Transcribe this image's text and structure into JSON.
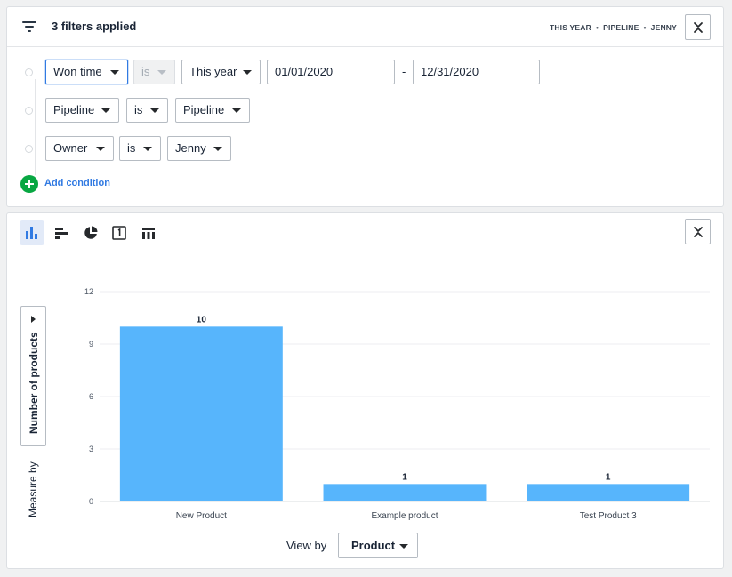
{
  "filters": {
    "title": "3 filters applied",
    "summary": [
      "THIS YEAR",
      "PIPELINE",
      "JENNY"
    ],
    "summary_separator": "•",
    "collapse_icon": "collapse-icon",
    "conditions": [
      {
        "field": "Won time",
        "operator": "is",
        "value": "This year",
        "from": "01/01/2020",
        "to": "12/31/2020",
        "range_separator": "-"
      },
      {
        "field": "Pipeline",
        "operator": "is",
        "value": "Pipeline"
      },
      {
        "field": "Owner",
        "operator": "is",
        "value": "Jenny"
      }
    ],
    "add_condition_label": "Add condition"
  },
  "chart_panel": {
    "view_tabs": [
      {
        "icon": "bar-chart-icon",
        "active": true
      },
      {
        "icon": "horizontal-bar-chart-icon",
        "active": false
      },
      {
        "icon": "pie-chart-icon",
        "active": false
      },
      {
        "icon": "scorecard-icon",
        "active": false
      },
      {
        "icon": "table-icon",
        "active": false
      }
    ],
    "measure_by_label": "Measure by",
    "measure_value": "Number of products",
    "view_by_label": "View by",
    "view_by_value": "Product"
  },
  "chart_data": {
    "type": "bar",
    "categories": [
      "New Product",
      "Example product",
      "Test Product 3"
    ],
    "values": [
      10,
      1,
      1
    ],
    "ylabel": "Number of products",
    "xlabel": "Product",
    "ylim": [
      0,
      12
    ],
    "yticks": [
      0,
      3,
      6,
      9,
      12
    ],
    "grid": true,
    "data_labels": true,
    "bar_color": "#57b5fc"
  },
  "colors": {
    "accent": "#317ae2",
    "add_button": "#08a742",
    "bar": "#57b5fc",
    "active_tab_bg": "#e2eaf8"
  }
}
